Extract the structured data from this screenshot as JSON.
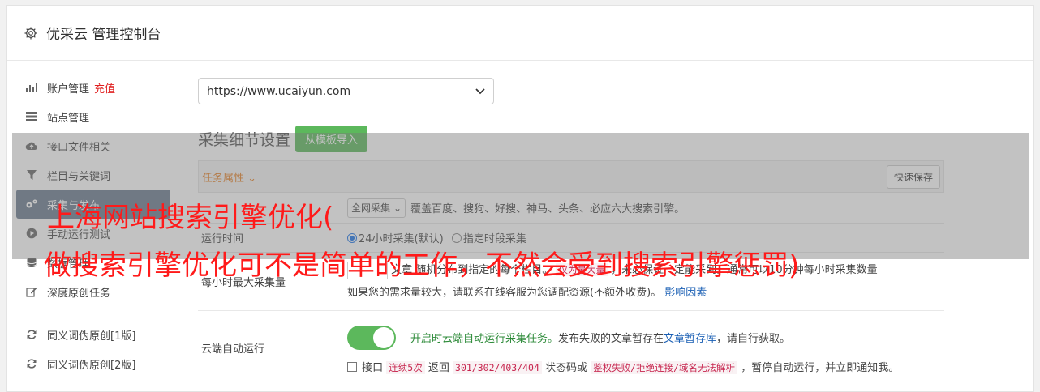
{
  "header": {
    "title": "优采云 管理控制台",
    "icon": "gear-icon"
  },
  "sidebar": {
    "items": [
      {
        "label": "账户管理",
        "badge": "充值",
        "icon": "bar-chart-icon"
      },
      {
        "label": "站点管理",
        "icon": "server-icon"
      },
      {
        "label": "接口文件相关",
        "icon": "cloud-upload-icon"
      },
      {
        "label": "栏目与关键词",
        "icon": "filter-icon"
      },
      {
        "label": "采集与发布",
        "icon": "gears-icon"
      },
      {
        "label": "手动运行测试",
        "icon": "play-circle-icon"
      },
      {
        "label": "数据管理",
        "icon": "database-icon"
      },
      {
        "label": "深度原创任务",
        "icon": "edit-icon"
      },
      {
        "label": "同义词伪原创[1版]",
        "icon": "refresh-icon"
      },
      {
        "label": "同义词伪原创[2版]",
        "icon": "refresh-icon"
      }
    ]
  },
  "main": {
    "site_select_value": "https://www.ucaiyun.com",
    "section_title": "采集细节设置",
    "import_button": "从模板导入",
    "task_tab": "任务属性 ⌄",
    "quick_save": "快速保存",
    "rows": {
      "engine_value": "全网采集",
      "engine_desc": "覆盖百度、搜狗、好搜、神马、头条、必应六大搜索引擎。",
      "runtime_label": "运行时间",
      "runtime_opt1": "24小时采集(默认)",
      "runtime_opt2": "指定时段采集",
      "max_label": "每小时最大采集量",
      "max_desc_a": "文章",
      "max_desc_b": "随机分布到指定的每个栏目。",
      "max_hint_code": "仅为最大量",
      "max_desc_c": "，未必保证一定能采到。通常可以10分钟每小时采集数量",
      "max_note": "如果您的需求量较大，请联系在线客服为您调配资源(不额外收费)。",
      "max_link": "影响因素",
      "cloud_label": "云端自动运行",
      "cloud_green": "开启时云端自动运行采集任务。",
      "cloud_desc": "发布失败的文章暂存在",
      "cloud_link": "文章暂存库",
      "cloud_desc2": "，请自行获取。",
      "cb_a": "接口",
      "cb_code1": "连续5次",
      "cb_b": "返回",
      "cb_code2": "301/302/403/404",
      "cb_c": "状态码或",
      "cb_code3": "鉴权失败/拒绝连接/域名无法解析",
      "cb_d": "，暂停自动运行，并立即通知我。"
    }
  },
  "overlay": {
    "line1": "上海网站搜索引擎优化(",
    "line2": "做搜索引擎优化可不是简单的工作，不然会受到搜索引擎惩罚)"
  },
  "colors": {
    "accent_green": "#5cb85c",
    "active_nav": "#6b7a8f",
    "overlay_text": "#ff1a1a"
  }
}
